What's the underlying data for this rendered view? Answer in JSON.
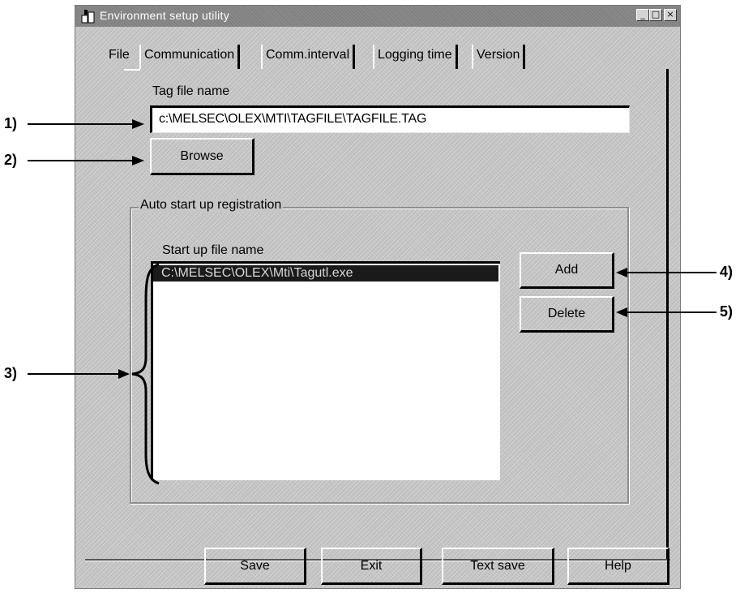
{
  "window": {
    "title": "Environment setup utility",
    "controls": {
      "minimize": "_",
      "maximize": "□",
      "close": "×"
    }
  },
  "tabs": [
    {
      "label": "File",
      "active": true
    },
    {
      "label": "Communication",
      "active": false
    },
    {
      "label": "Comm.interval",
      "active": false
    },
    {
      "label": "Logging time",
      "active": false
    },
    {
      "label": "Version",
      "active": false
    }
  ],
  "file_tab": {
    "tag_file_label": "Tag file name",
    "tag_file_value": "c:\\MELSEC\\OLEX\\MTI\\TAGFILE\\TAGFILE.TAG",
    "browse_label": "Browse",
    "group_label": "Auto start up registration",
    "startup_label": "Start up file name",
    "startup_items": [
      "C:\\MELSEC\\OLEX\\Mti\\Tagutl.exe"
    ],
    "add_label": "Add",
    "delete_label": "Delete"
  },
  "footer": {
    "save_label": "Save",
    "exit_label": "Exit",
    "text_save_label": "Text save",
    "help_label": "Help"
  },
  "callouts": {
    "c1": "1)",
    "c2": "2)",
    "c3": "3)",
    "c4": "4)",
    "c5": "5)"
  }
}
